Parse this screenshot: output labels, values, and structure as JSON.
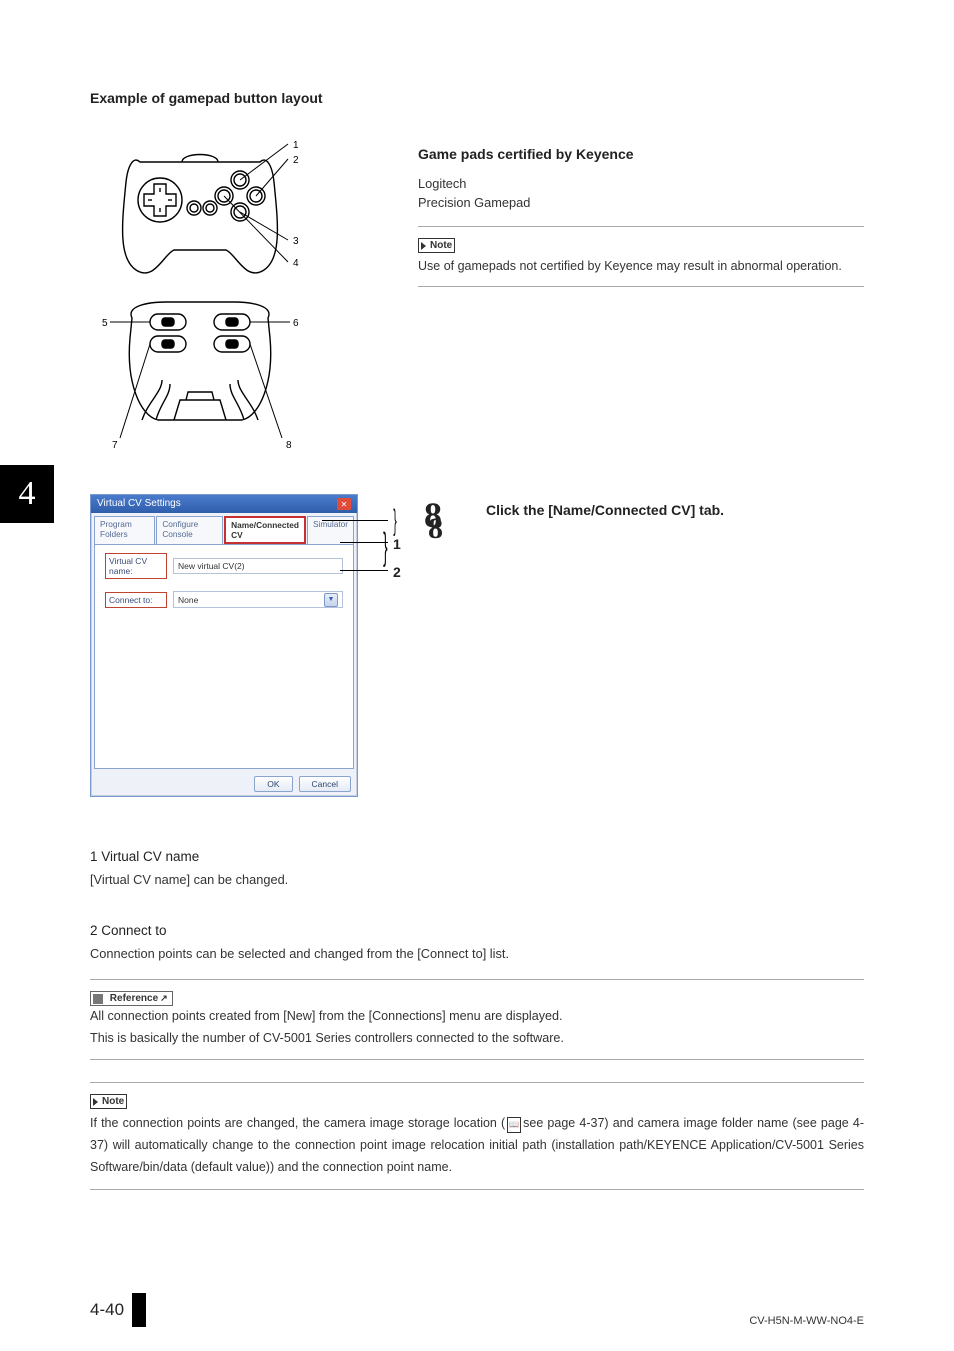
{
  "chapter_tab": "4",
  "heading_layout": "Example of gamepad button layout",
  "gamepad": {
    "markers": {
      "m1": "1",
      "m2": "2",
      "m3": "3",
      "m4": "4",
      "m5": "5",
      "m6": "6",
      "m7": "7",
      "m8": "8"
    }
  },
  "right": {
    "heading": "Game pads certified by Keyence",
    "line1": "Logitech",
    "line2": "Precision Gamepad",
    "note_label": "Note",
    "note_text": "Use of gamepads not certified by Keyence may result in abnormal operation."
  },
  "dialog": {
    "title": "Virtual CV Settings",
    "tabs": {
      "t1": "Program Folders",
      "t2": "Configure Console",
      "t3": "Name/Connected CV",
      "t4": "Simulator"
    },
    "row1": {
      "label": "Virtual CV name:",
      "value": "New virtual CV(2)"
    },
    "row2": {
      "label": "Connect to:",
      "value": "None"
    },
    "ok": "OK",
    "cancel": "Cancel"
  },
  "callouts": {
    "c8": "8",
    "c1": "1",
    "c2": "2"
  },
  "step": {
    "big8l": "8",
    "big8r": "8",
    "text": "Click the [Name/Connected CV] tab."
  },
  "s1_head": "1    Virtual CV name",
  "s1_text": "[Virtual CV name] can be changed.",
  "s2_head": "2    Connect to",
  "s2_text": "Connection points can be selected and changed from the [Connect to] list.",
  "ref_label": "Reference",
  "ref_line1": "All connection points created from  [New] from the [Connections] menu are displayed.",
  "ref_line2": "This is basically the number of CV-5001 Series controllers connected to the software.",
  "note2_label": "Note",
  "note2_text_a": "If the connection points are changed, the camera image storage location (",
  "note2_text_b": "see page 4-37) and camera image folder name (see page 4-37) will automatically change to the connection point image relocation initial path (installation path/KEYENCE Application/CV-5001 Series Software/bin/data (default value)) and the connection point name.",
  "footer": {
    "page": "4-40",
    "right": "CV-H5N-M-WW-NO4-E"
  }
}
